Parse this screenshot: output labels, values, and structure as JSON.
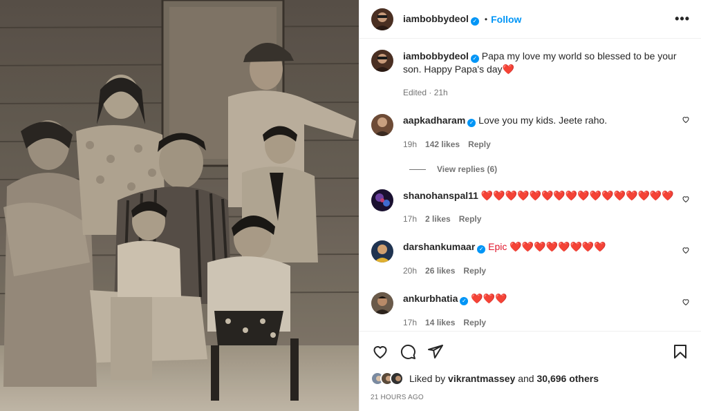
{
  "post": {
    "username": "iambobbydeol",
    "follow_label": "Follow",
    "dot": "•",
    "more_label": "•••",
    "caption_user": "iambobbydeol",
    "caption_text": "Papa my love my world so blessed to be your son. Happy Papa's day",
    "caption_emoji": "❤️",
    "edited": "Edited · 21h"
  },
  "comments": [
    {
      "user": "aapkadharam",
      "verified": true,
      "text": "Love you my kids. Jeete raho.",
      "time": "19h",
      "likes": "142 likes",
      "reply": "Reply"
    },
    {
      "user": "shanohanspal11",
      "verified": false,
      "text": "❤️❤️❤️❤️❤️❤️❤️❤️❤️❤️❤️❤️❤️❤️❤️❤️",
      "time": "17h",
      "likes": "2 likes",
      "reply": "Reply"
    },
    {
      "user": "darshankumaar",
      "verified": true,
      "text": "Epic ❤️❤️❤️❤️❤️❤️❤️❤️",
      "time": "20h",
      "likes": "26 likes",
      "reply": "Reply"
    },
    {
      "user": "ankurbhatia",
      "verified": true,
      "text": "❤️❤️❤️",
      "time": "17h",
      "likes": "14 likes",
      "reply": "Reply"
    }
  ],
  "view_replies": "View replies (6)",
  "likes": {
    "prefix": "Liked by",
    "user": "vikrantmassey",
    "middle": "and",
    "count": "30,696 others"
  },
  "timestamp": "21 HOURS AGO",
  "icons": {
    "like": "heart-icon",
    "comment": "comment-icon",
    "share": "share-icon",
    "save": "bookmark-icon",
    "verified": "verified-badge-icon"
  },
  "colors": {
    "accent": "#0095f6",
    "heart": "#e0162b",
    "muted": "#737373"
  }
}
